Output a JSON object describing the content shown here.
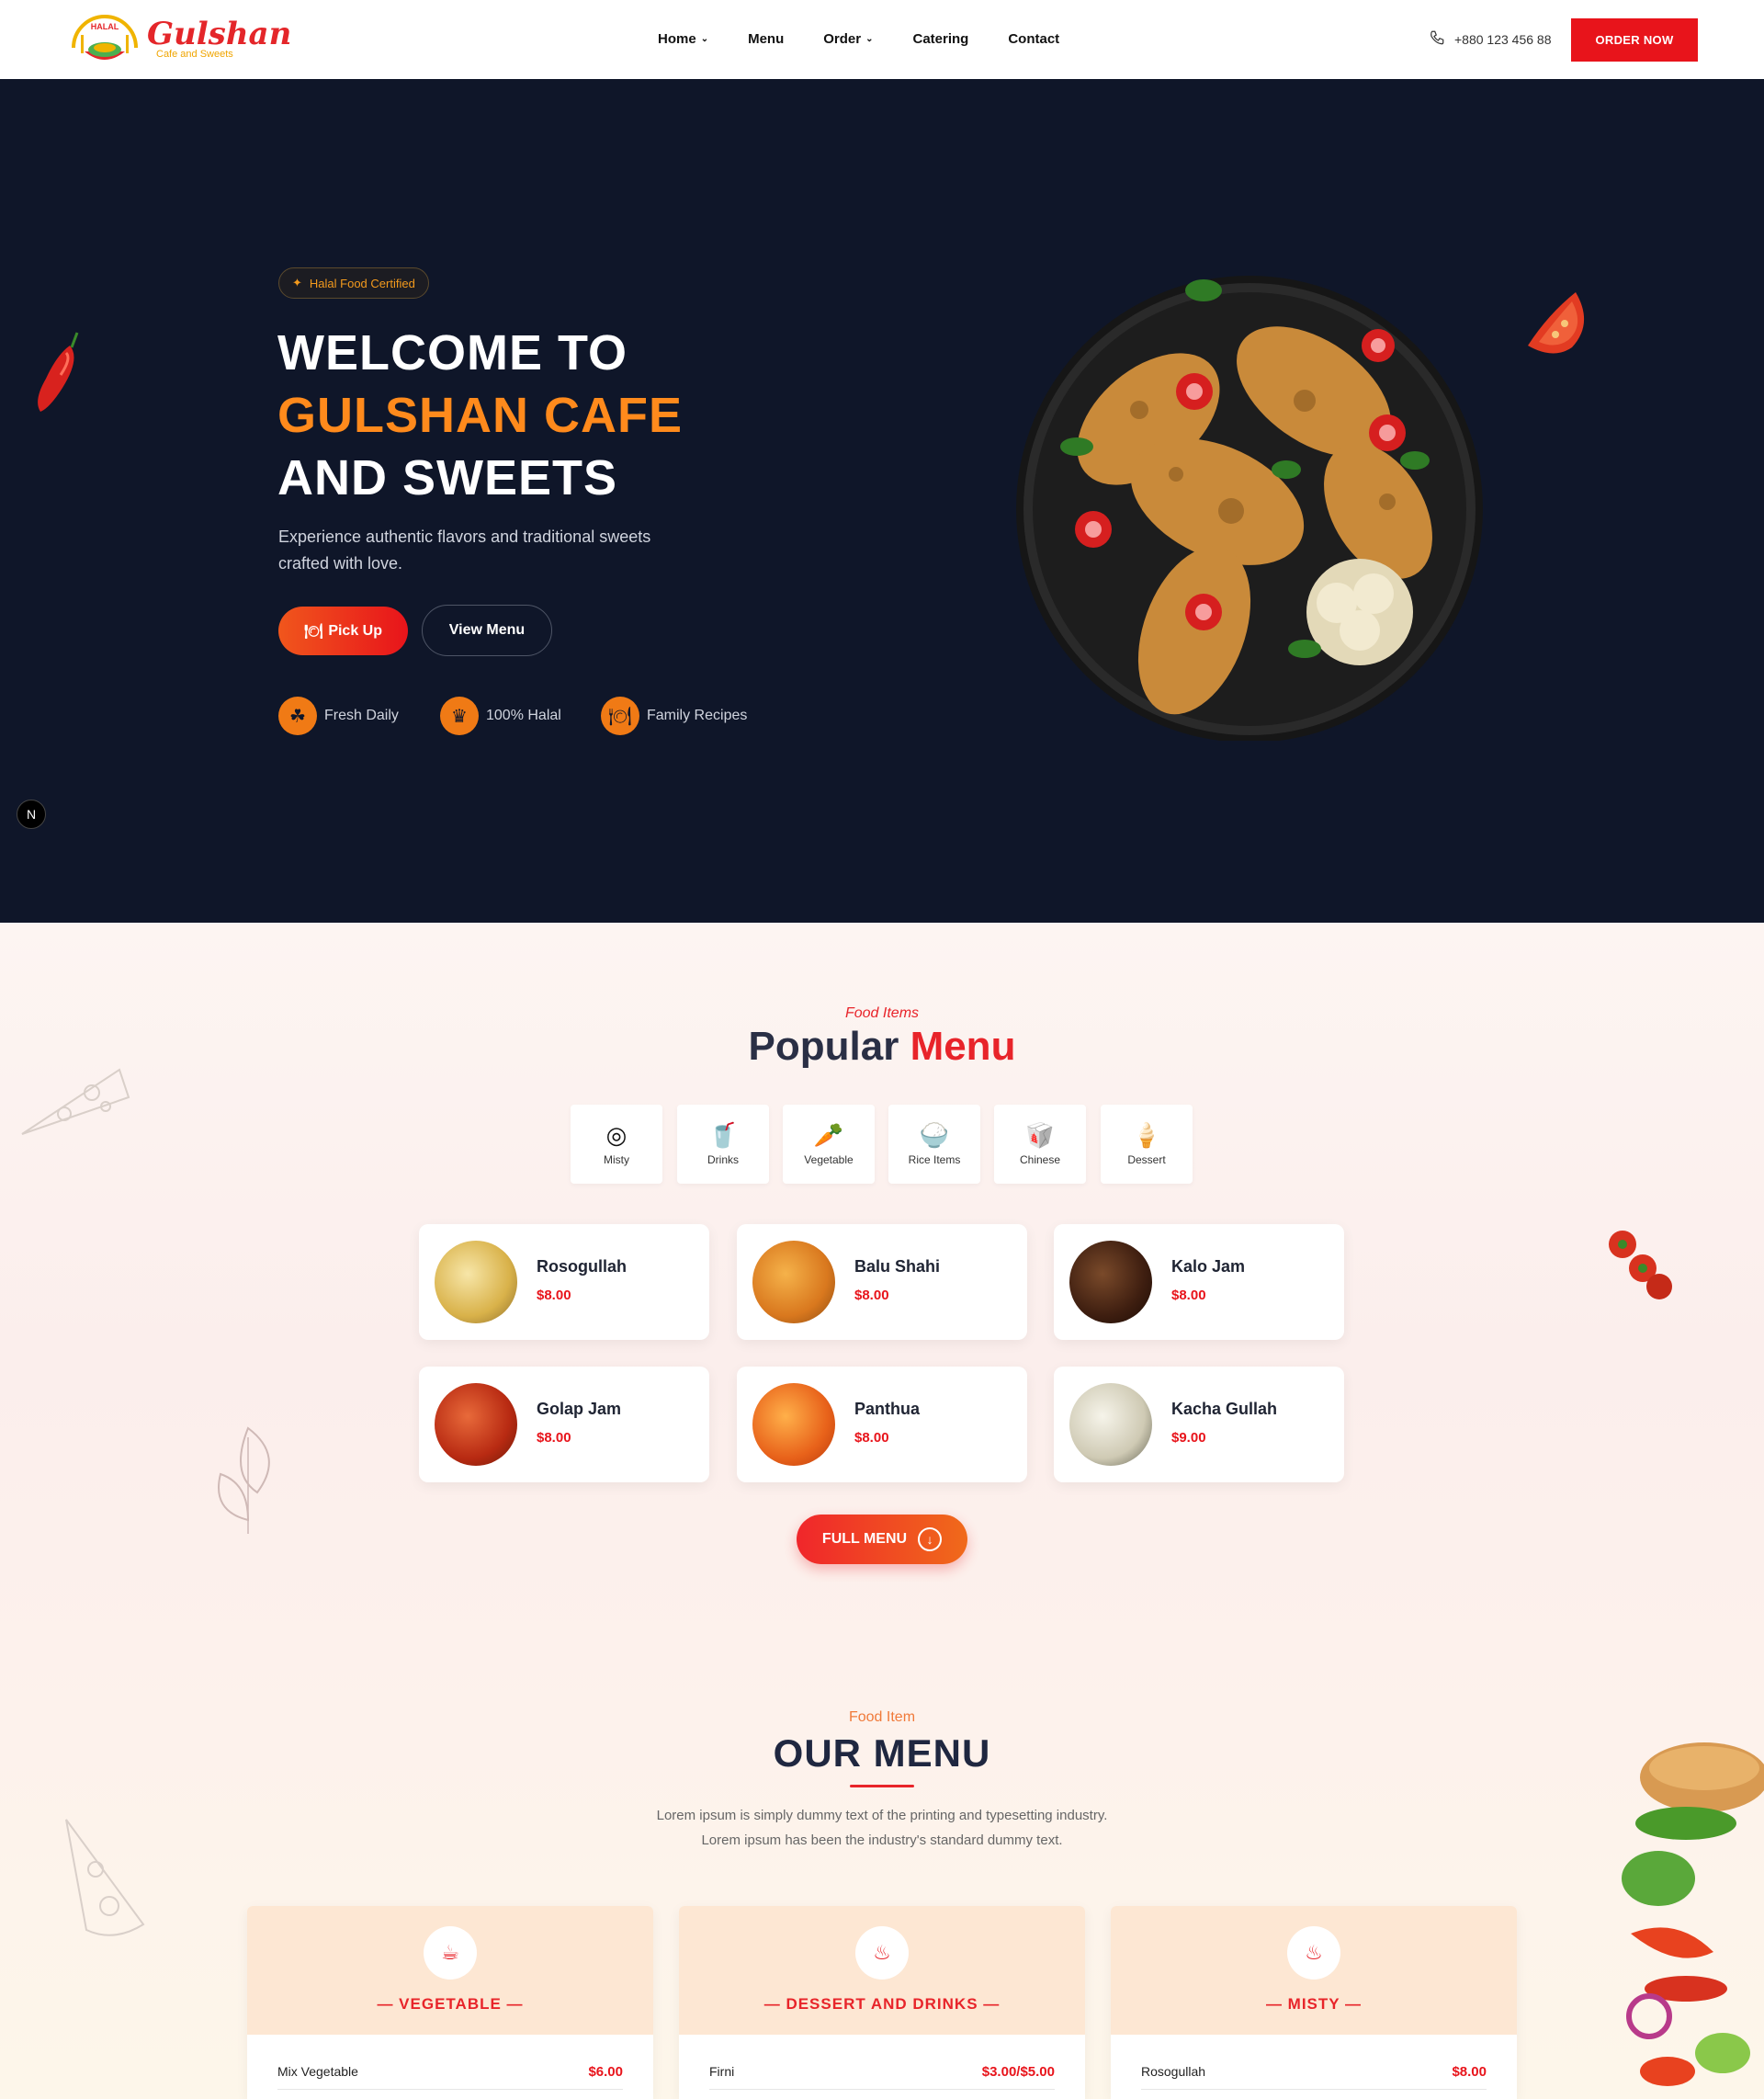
{
  "header": {
    "logo": {
      "badge_text": "HALAL",
      "title": "Gulshan",
      "subtitle": "Cafe and Sweets"
    },
    "nav": [
      {
        "label": "Home",
        "dropdown": true
      },
      {
        "label": "Menu",
        "dropdown": false
      },
      {
        "label": "Order",
        "dropdown": true
      },
      {
        "label": "Catering",
        "dropdown": false
      },
      {
        "label": "Contact",
        "dropdown": false
      }
    ],
    "phone": "+880 123 456 88",
    "order_button": "ORDER NOW"
  },
  "hero": {
    "badge": "Halal Food Certified",
    "title_line1": "WELCOME TO",
    "title_line2": "GULSHAN CAFE",
    "title_line3": "AND SWEETS",
    "description": "Experience authentic flavors and traditional sweets crafted with love.",
    "pickup_button": "Pick Up",
    "view_menu_button": "View Menu",
    "features": [
      {
        "label": "Fresh Daily",
        "icon": "clover-icon"
      },
      {
        "label": "100% Halal",
        "icon": "medal-icon"
      },
      {
        "label": "Family Recipes",
        "icon": "dinner-icon"
      }
    ],
    "n_badge": "N"
  },
  "popular": {
    "subtitle": "Food Items",
    "title": "Popular",
    "title_accent": "Menu",
    "categories": [
      {
        "label": "Misty",
        "icon": "sweet-icon"
      },
      {
        "label": "Drinks",
        "icon": "drink-icon"
      },
      {
        "label": "Vegetable",
        "icon": "carrot-icon"
      },
      {
        "label": "Rice Items",
        "icon": "rice-bowl-icon"
      },
      {
        "label": "Chinese",
        "icon": "takeout-icon"
      },
      {
        "label": "Dessert",
        "icon": "ice-cream-icon"
      }
    ],
    "items": [
      {
        "name": "Rosogullah",
        "price": "$8.00"
      },
      {
        "name": "Balu Shahi",
        "price": "$8.00"
      },
      {
        "name": "Kalo Jam",
        "price": "$8.00"
      },
      {
        "name": "Golap Jam",
        "price": "$8.00"
      },
      {
        "name": "Panthua",
        "price": "$8.00"
      },
      {
        "name": "Kacha Gullah",
        "price": "$9.00"
      }
    ],
    "full_menu_button": "FULL MENU"
  },
  "our_menu": {
    "subtitle": "Food Item",
    "title": "OUR MENU",
    "description_line1": "Lorem ipsum is simply dummy text of the printing and typesetting industry.",
    "description_line2": "Lorem ipsum has been the industry's standard dummy text.",
    "cards": [
      {
        "title": "— VEGETABLE —",
        "icon": "cup-icon",
        "first_item": "Mix Vegetable",
        "first_price": "$6.00"
      },
      {
        "title": "— DESSERT AND DRINKS —",
        "icon": "chef-hat-icon",
        "first_item": "Firni",
        "first_price": "$3.00/$5.00"
      },
      {
        "title": "— MISTY —",
        "icon": "chef-hat-icon",
        "first_item": "Rosogullah",
        "first_price": "$8.00"
      }
    ]
  },
  "colors": {
    "brand_red": "#e8141b",
    "accent_orange": "#ff8a1c",
    "hero_bg": "#0f1629"
  }
}
